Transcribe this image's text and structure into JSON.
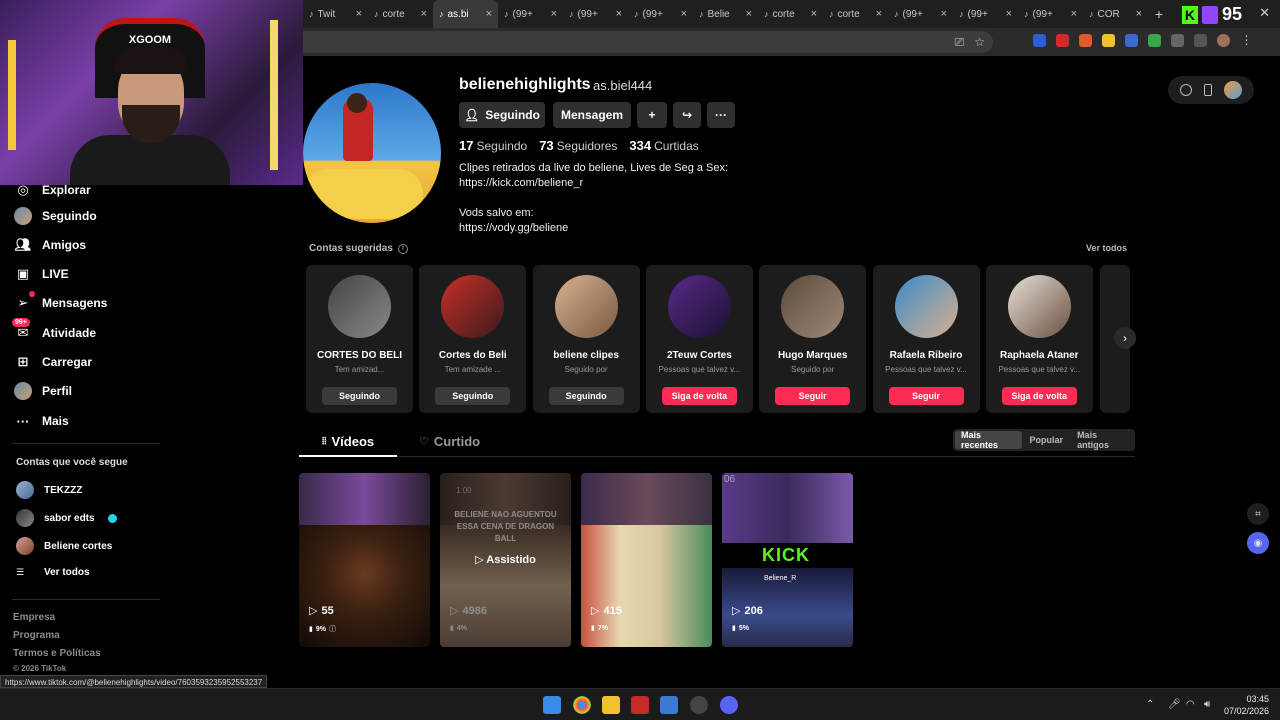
{
  "browser": {
    "tabs": [
      {
        "label": "Twit",
        "active": false
      },
      {
        "label": "corte",
        "active": false
      },
      {
        "label": "as.bi",
        "active": true
      },
      {
        "label": "(99+",
        "active": false
      },
      {
        "label": "(99+",
        "active": false
      },
      {
        "label": "(99+",
        "active": false
      },
      {
        "label": "Belie",
        "active": false
      },
      {
        "label": "corte",
        "active": false
      },
      {
        "label": "corte",
        "active": false
      },
      {
        "label": "(99+",
        "active": false
      },
      {
        "label": "(99+",
        "active": false
      },
      {
        "label": "(99+",
        "active": false
      },
      {
        "label": "COR",
        "active": false
      }
    ],
    "kick_count": "95",
    "status_url": "https://www.tiktok.com/@belienehighlights/video/7603593235952553237"
  },
  "webcam": {
    "brand": "XGOOM"
  },
  "sidebar": {
    "nav": [
      {
        "label": "Explorar",
        "icon": "compass-icon"
      },
      {
        "label": "Seguindo",
        "icon": "avatar-icon"
      },
      {
        "label": "Amigos",
        "icon": "friends-icon"
      },
      {
        "label": "LIVE",
        "icon": "live-icon"
      },
      {
        "label": "Mensagens",
        "icon": "send-icon",
        "badge": "1"
      },
      {
        "label": "Atividade",
        "icon": "inbox-icon",
        "badge": "99+"
      },
      {
        "label": "Carregar",
        "icon": "upload-icon"
      },
      {
        "label": "Perfil",
        "icon": "profile-icon"
      },
      {
        "label": "Mais",
        "icon": "more-icon"
      }
    ],
    "following_title": "Contas que você segue",
    "following": [
      {
        "name": "TEKZZZ",
        "verified": false
      },
      {
        "name": "sabor edts",
        "verified": true
      },
      {
        "name": "Beliene cortes",
        "verified": false
      }
    ],
    "see_all": "Ver todos",
    "footer": [
      "Empresa",
      "Programa",
      "Termos e Políticas",
      "© 2026 TikTok"
    ]
  },
  "profile": {
    "username": "belienehighlights",
    "handle": "as.biel444",
    "buttons": {
      "following": "Seguindo",
      "message": "Mensagem"
    },
    "stats": {
      "following_count": "17",
      "following_label": "Seguindo",
      "followers_count": "73",
      "followers_label": "Seguidores",
      "likes_count": "334",
      "likes_label": "Curtidas"
    },
    "bio": {
      "line1": "Clipes retirados da live do beliene, Lives de Seg a Sex:",
      "line2": "https://kick.com/beliene_r",
      "line3": "Vods salvo em:",
      "line4": "https://vody.gg/beliene"
    }
  },
  "suggested": {
    "title": "Contas sugeridas",
    "see_all": "Ver todos",
    "cards": [
      {
        "name": "CORTES DO BELI",
        "sub": "Tem amizad...",
        "button": "Seguindo",
        "style": "gray"
      },
      {
        "name": "Cortes do Beli",
        "sub": "Tem amizade ...",
        "button": "Seguindo",
        "style": "gray"
      },
      {
        "name": "beliene clipes",
        "sub": "Seguido por",
        "button": "Seguindo",
        "style": "gray"
      },
      {
        "name": "2Teuw Cortes",
        "sub": "Pessoas que talvez v...",
        "button": "Siga de volta",
        "style": "red"
      },
      {
        "name": "Hugo Marques",
        "sub": "Seguido por",
        "button": "Seguir",
        "style": "red"
      },
      {
        "name": "Rafaela Ribeiro",
        "sub": "Pessoas que talvez v...",
        "button": "Seguir",
        "style": "red"
      },
      {
        "name": "Raphaela Ataner",
        "sub": "Pessoas que talvez v...",
        "button": "Siga de volta",
        "style": "red"
      }
    ]
  },
  "content_tabs": {
    "videos": "Vídeos",
    "likes": "Curtido"
  },
  "sort": {
    "recent": "Mais recentes",
    "popular": "Popular",
    "oldest": "Mais antigos"
  },
  "videos": [
    {
      "plays": "55",
      "pct": "9%"
    },
    {
      "plays": "4986",
      "pct": "4%",
      "overlay": "Assistido",
      "caption": "BELIENE NAO AGUENTOU ESSA CENA DE DRAGON BALL",
      "time": "1.00"
    },
    {
      "plays": "415",
      "pct": "7%"
    },
    {
      "plays": "206",
      "pct": "5%",
      "kick": "KICK",
      "kick_name": "Beliene_R",
      "num": "06"
    }
  ],
  "taskbar": {
    "time": "03:45",
    "date": "07/02/2026"
  }
}
